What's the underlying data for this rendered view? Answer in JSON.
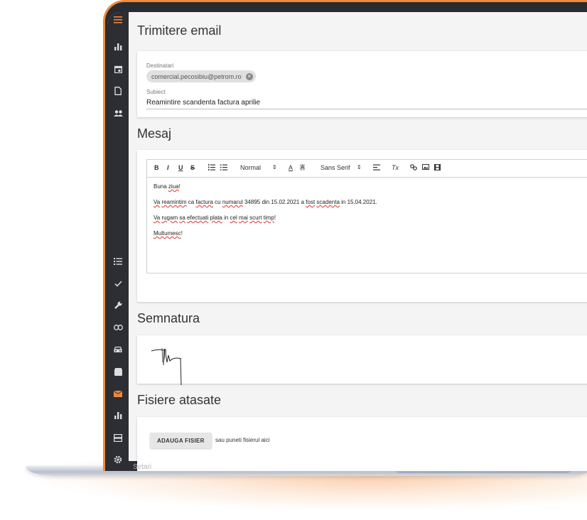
{
  "colors": {
    "accent": "#f0883a",
    "rail": "#2d2e33",
    "background": "#f4f4f4"
  },
  "rail": {
    "icons": [
      {
        "name": "menu-icon",
        "glyph": "☰",
        "active": true
      },
      {
        "name": "bar-chart-icon",
        "glyph": "▮"
      },
      {
        "name": "calendar-icon",
        "glyph": "▣"
      },
      {
        "name": "document-icon",
        "glyph": "▯"
      },
      {
        "name": "people-icon",
        "glyph": "👥"
      },
      {
        "name": "list-icon",
        "glyph": "☰"
      },
      {
        "name": "check-icon",
        "glyph": "✓"
      },
      {
        "name": "wrench-icon",
        "glyph": "🔧"
      },
      {
        "name": "link-icon",
        "glyph": "⊖"
      },
      {
        "name": "car-icon",
        "glyph": "🚗"
      },
      {
        "name": "archive-icon",
        "glyph": "▇"
      },
      {
        "name": "mail-icon",
        "glyph": "✉",
        "active": true
      },
      {
        "name": "bar-chart-icon-2",
        "glyph": "▮"
      },
      {
        "name": "storage-icon",
        "glyph": "☰"
      },
      {
        "name": "settings-icon",
        "glyph": "⚙"
      }
    ],
    "settings_label": "Setari"
  },
  "email": {
    "title": "Trimitere email",
    "recipients_label": "Destinatari",
    "recipient": "comercial.pecosibiu@petrom.ro",
    "subject_label": "Subiect",
    "subject": "Reamintire scandenta factura aprilie"
  },
  "message": {
    "title": "Mesaj",
    "toolbar": {
      "bold": "B",
      "italic": "I",
      "underline": "U",
      "strike": "S",
      "ordered_list": "⅓",
      "bullet_list": "☰",
      "format": "Normal",
      "font": "Sans Serif",
      "text_color": "A",
      "bg_color": "A",
      "align": "≡",
      "clear": "Tx",
      "link": "🔗",
      "image": "▣",
      "video": "▤"
    },
    "lines": [
      "Buna ziua!",
      "Va reamintim ca factura cu numarul 34895 din 15.02.2021 a fost scadenta in 15.04.2021.",
      "Va rugam sa efectuati plata in cel mai scurt timp!",
      "Multumesc!"
    ]
  },
  "signature": {
    "title": "Semnatura"
  },
  "attachments": {
    "title": "Fisiere atasate",
    "upload_button": "ADAUGA FISIER",
    "drop_hint": "sau puneti fisierul aici"
  }
}
